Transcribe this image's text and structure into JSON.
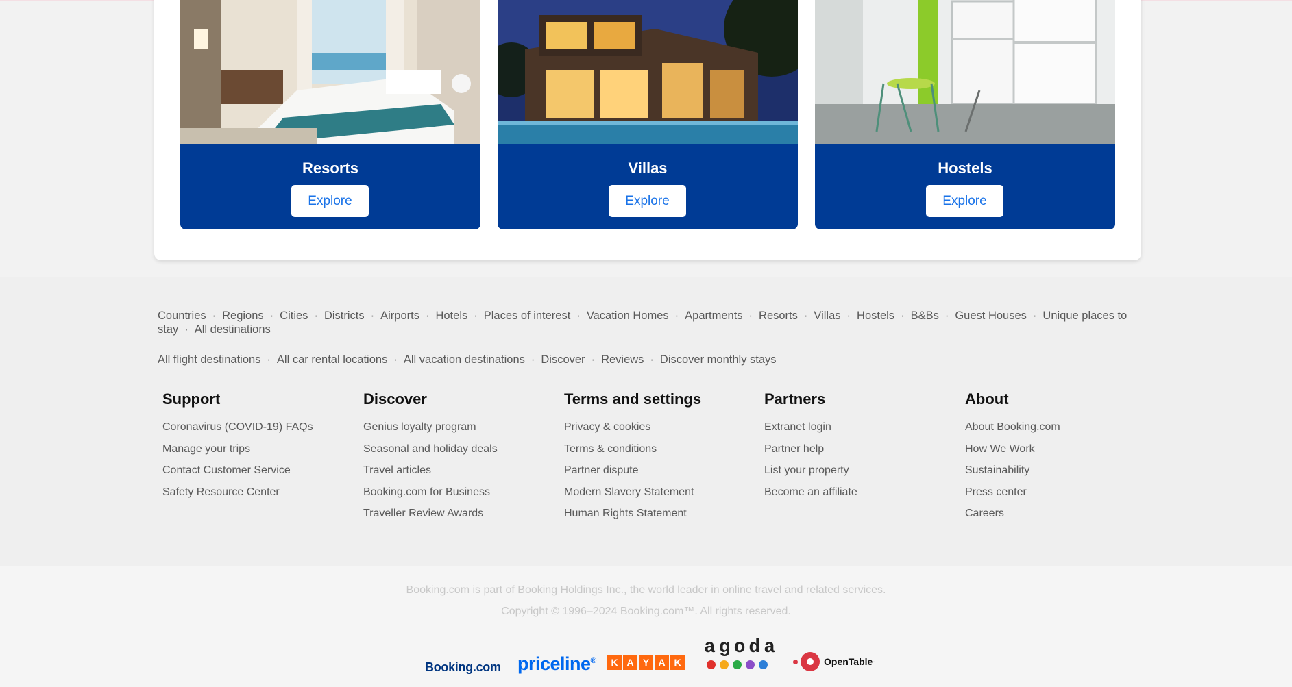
{
  "property_types": [
    {
      "title": "Resorts",
      "button": "Explore"
    },
    {
      "title": "Villas",
      "button": "Explore"
    },
    {
      "title": "Hostels",
      "button": "Explore"
    }
  ],
  "footer": {
    "links_row1": [
      "Countries",
      "Regions",
      "Cities",
      "Districts",
      "Airports",
      "Hotels",
      "Places of interest",
      "Vacation Homes",
      "Apartments",
      "Resorts",
      "Villas",
      "Hostels",
      "B&Bs",
      "Guest Houses",
      "Unique places to stay",
      "All destinations"
    ],
    "links_row2": [
      "All flight destinations",
      "All car rental locations",
      "All vacation destinations",
      "Discover",
      "Reviews",
      "Discover monthly stays"
    ],
    "columns": [
      {
        "heading": "Support",
        "links": [
          "Coronavirus (COVID-19) FAQs",
          "Manage your trips",
          "Contact Customer Service",
          "Safety Resource Center"
        ]
      },
      {
        "heading": "Discover",
        "links": [
          "Genius loyalty program",
          "Seasonal and holiday deals",
          "Travel articles",
          "Booking.com for Business",
          "Traveller Review Awards"
        ]
      },
      {
        "heading": "Terms and settings",
        "links": [
          "Privacy & cookies",
          "Terms & conditions",
          "Partner dispute",
          "Modern Slavery Statement",
          "Human Rights Statement"
        ]
      },
      {
        "heading": "Partners",
        "links": [
          "Extranet login",
          "Partner help",
          "List your property",
          "Become an affiliate"
        ]
      },
      {
        "heading": "About",
        "links": [
          "About Booking.com",
          "How We Work",
          "Sustainability",
          "Press center",
          "Careers"
        ]
      }
    ],
    "legal_line1": "Booking.com is part of Booking Holdings Inc., the world leader in online travel and related services.",
    "legal_line2": "Copyright © 1996–2024 Booking.com™. All rights reserved.",
    "brand_logos": {
      "booking": "Booking.com",
      "priceline": "priceline",
      "priceline_mark": "®",
      "kayak": [
        "K",
        "A",
        "Y",
        "A",
        "K"
      ],
      "agoda": "agoda",
      "agoda_dot_colors": [
        "#e0312c",
        "#f6a91b",
        "#2bab47",
        "#8b4ec8",
        "#2d7fd8"
      ],
      "opentable": "OpenTable",
      "opentable_mark": "·"
    }
  },
  "colors": {
    "card_blue": "#003b95",
    "explore_text": "#1a73e8",
    "footer_bg": "#efefef"
  }
}
